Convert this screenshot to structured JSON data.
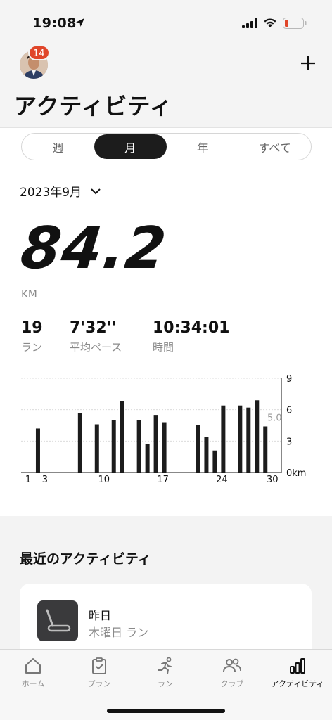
{
  "status": {
    "time": "19:08"
  },
  "header": {
    "badge_count": "14",
    "title": "アクティビティ"
  },
  "segment": {
    "tabs": [
      "週",
      "月",
      "年",
      "すべて"
    ],
    "active_index": 1
  },
  "period": {
    "label": "2023年9月"
  },
  "summary": {
    "distance": "84.2",
    "unit": "KM",
    "runs": {
      "value": "19",
      "label": "ラン"
    },
    "pace": {
      "value": "7'32''",
      "label": "平均ペース"
    },
    "time": {
      "value": "10:34:01",
      "label": "時間"
    }
  },
  "chart_data": {
    "type": "bar",
    "x": [
      2,
      7,
      9,
      11,
      12,
      14,
      15,
      16,
      17,
      21,
      22,
      23,
      24,
      26,
      27,
      28,
      29
    ],
    "values": [
      4.2,
      5.7,
      4.6,
      5.0,
      6.8,
      5.0,
      2.7,
      5.5,
      4.8,
      4.5,
      3.4,
      2.1,
      6.4,
      6.4,
      6.2,
      6.9,
      4.4
    ],
    "x_tick_labels": [
      "1",
      "3",
      "10",
      "17",
      "24",
      "30"
    ],
    "y_tick_labels": [
      "9",
      "6",
      "3",
      "0km"
    ],
    "ylim": [
      0,
      9
    ],
    "average_line": {
      "value": 5.0,
      "label": "5.0"
    },
    "grid": true
  },
  "recent": {
    "title": "最近のアクティビティ",
    "item": {
      "date": "昨日",
      "subtitle": "木曜日 ラン"
    }
  },
  "tabs": [
    {
      "label": "ホーム",
      "icon": "home-icon"
    },
    {
      "label": "プラン",
      "icon": "clipboard-icon"
    },
    {
      "label": "ラン",
      "icon": "runner-icon"
    },
    {
      "label": "クラブ",
      "icon": "people-icon"
    },
    {
      "label": "アクティビティ",
      "icon": "bar-chart-icon"
    }
  ],
  "colors": {
    "accent": "#1c1c1c",
    "badge": "#e0462a",
    "battery_low": "#e0462a"
  }
}
